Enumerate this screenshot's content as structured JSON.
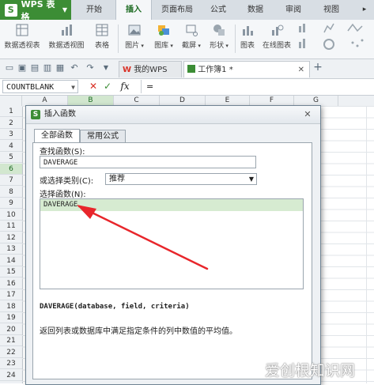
{
  "app": {
    "name": "WPS 表格"
  },
  "ribbon_tabs": [
    "开始",
    "插入",
    "页面布局",
    "公式",
    "数据",
    "审阅",
    "视图"
  ],
  "ribbon_active_tab": "插入",
  "ribbon_buttons": [
    "数据透视表",
    "数据透视图",
    "表格",
    "图片",
    "图库",
    "截屏",
    "形状",
    "图表",
    "在线图表"
  ],
  "doc_tabs": [
    {
      "label": "我的WPS"
    },
    {
      "label": "工作簿1 *"
    }
  ],
  "formula_bar": {
    "name_box": "COUNTBLANK",
    "cancel": "✕",
    "confirm": "✓",
    "fx": "fx",
    "content": "="
  },
  "columns": [
    "A",
    "B",
    "C",
    "D",
    "E",
    "F",
    "G"
  ],
  "selected_column": "B",
  "rows": [
    "1",
    "2",
    "3",
    "4",
    "5",
    "6",
    "7",
    "8",
    "9",
    "10",
    "11",
    "12",
    "13",
    "14",
    "15",
    "16",
    "17",
    "18",
    "19",
    "20",
    "21",
    "22",
    "23",
    "24"
  ],
  "selected_row": "6",
  "dialog": {
    "title": "插入函数",
    "tabs": [
      "全部函数",
      "常用公式"
    ],
    "search_label": "查找函数(S):",
    "search_value": "DAVERAGE",
    "category_label": "或选择类别(C):",
    "category_value": "推荐",
    "list_label": "选择函数(N):",
    "functions": [
      "DAVERAGE"
    ],
    "syntax": "DAVERAGE(database, field, criteria)",
    "description": "返回列表或数据库中满足指定条件的列中数值的平均值。"
  },
  "watermark": "爱创根知识网",
  "colors": {
    "brand_green": "#3c8d35",
    "selection_green": "#d6ebd1",
    "arrow_red": "#e8262b"
  }
}
